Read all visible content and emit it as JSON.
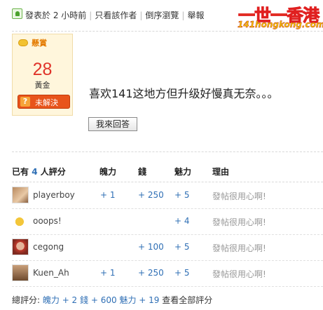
{
  "topbar": {
    "posted": "發表於 2 小時前",
    "only_author": "只看該作者",
    "reverse": "倒序瀏覽",
    "report": "舉報"
  },
  "logo": {
    "cn": "一世一香港",
    "en": "141hongkong.com"
  },
  "reward": {
    "label": "懸賞",
    "amount": "28",
    "unit": "黃金",
    "status_button": "未解決",
    "status_icon": "?"
  },
  "post": {
    "message": "喜欢141这地方但升级好慢真无奈。。。",
    "answer_button": "我來回答"
  },
  "ratings": {
    "header": {
      "prefix": "已有",
      "count": "4",
      "suffix": "人評分"
    },
    "columns": [
      "魄力",
      "錢",
      "魅力",
      "理由"
    ],
    "rows": [
      {
        "user": "playerboy",
        "power": "+ 1",
        "money": "+ 250",
        "charm": "+ 5",
        "reason": "發帖很用心啊!"
      },
      {
        "user": "ooops!",
        "power": "",
        "money": "",
        "charm": "+ 4",
        "reason": "發帖很用心啊!"
      },
      {
        "user": "cegong",
        "power": "",
        "money": "+ 100",
        "charm": "+ 5",
        "reason": "發帖很用心啊!"
      },
      {
        "user": "Kuen_Ah",
        "power": "+ 1",
        "money": "+ 250",
        "charm": "+ 5",
        "reason": "發帖很用心啊!"
      }
    ],
    "total": {
      "label": "總評分:",
      "power": "魄力 + 2",
      "money": "錢 + 600",
      "charm": "魅力 + 19",
      "view_all": "查看全部評分"
    }
  }
}
